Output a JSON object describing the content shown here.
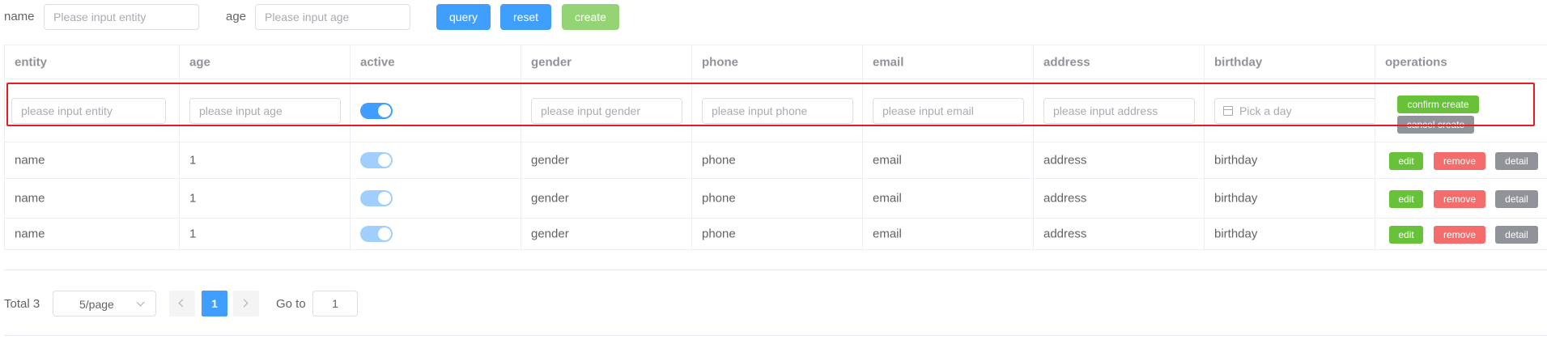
{
  "search": {
    "name_label": "name",
    "name_placeholder": "Please input entity",
    "age_label": "age",
    "age_placeholder": "Please input age",
    "query_label": "query",
    "reset_label": "reset",
    "create_label": "create"
  },
  "table": {
    "headers": [
      "entity",
      "age",
      "active",
      "gender",
      "phone",
      "email",
      "address",
      "birthday",
      "operations"
    ],
    "new_row": {
      "entity_placeholder": "please input entity",
      "age_placeholder": "please input age",
      "active": true,
      "gender_placeholder": "please input gender",
      "phone_placeholder": "please input phone",
      "email_placeholder": "please input email",
      "address_placeholder": "please input address",
      "birthday_placeholder": "Pick a day",
      "confirm_label": "confirm create",
      "cancel_label": "cancel create"
    },
    "rows": [
      {
        "entity": "name",
        "age": "1",
        "active": true,
        "gender": "gender",
        "phone": "phone",
        "email": "email",
        "address": "address",
        "birthday": "birthday"
      },
      {
        "entity": "name",
        "age": "1",
        "active": true,
        "gender": "gender",
        "phone": "phone",
        "email": "email",
        "address": "address",
        "birthday": "birthday"
      },
      {
        "entity": "name",
        "age": "1",
        "active": true,
        "gender": "gender",
        "phone": "phone",
        "email": "email",
        "address": "address",
        "birthday": "birthday"
      }
    ],
    "row_actions": {
      "edit": "edit",
      "remove": "remove",
      "detail": "detail"
    }
  },
  "pagination": {
    "total": "Total 3",
    "page_size": "5/page",
    "current_page": "1",
    "goto_label": "Go to",
    "goto_value": "1"
  },
  "colors": {
    "primary": "#409eff",
    "success": "#67c23a",
    "danger": "#f56c6c",
    "info": "#909399",
    "highlight": "#e51c23"
  },
  "icons": [
    "calendar-icon",
    "chevron-down-icon",
    "chevron-left-icon",
    "chevron-right-icon"
  ]
}
